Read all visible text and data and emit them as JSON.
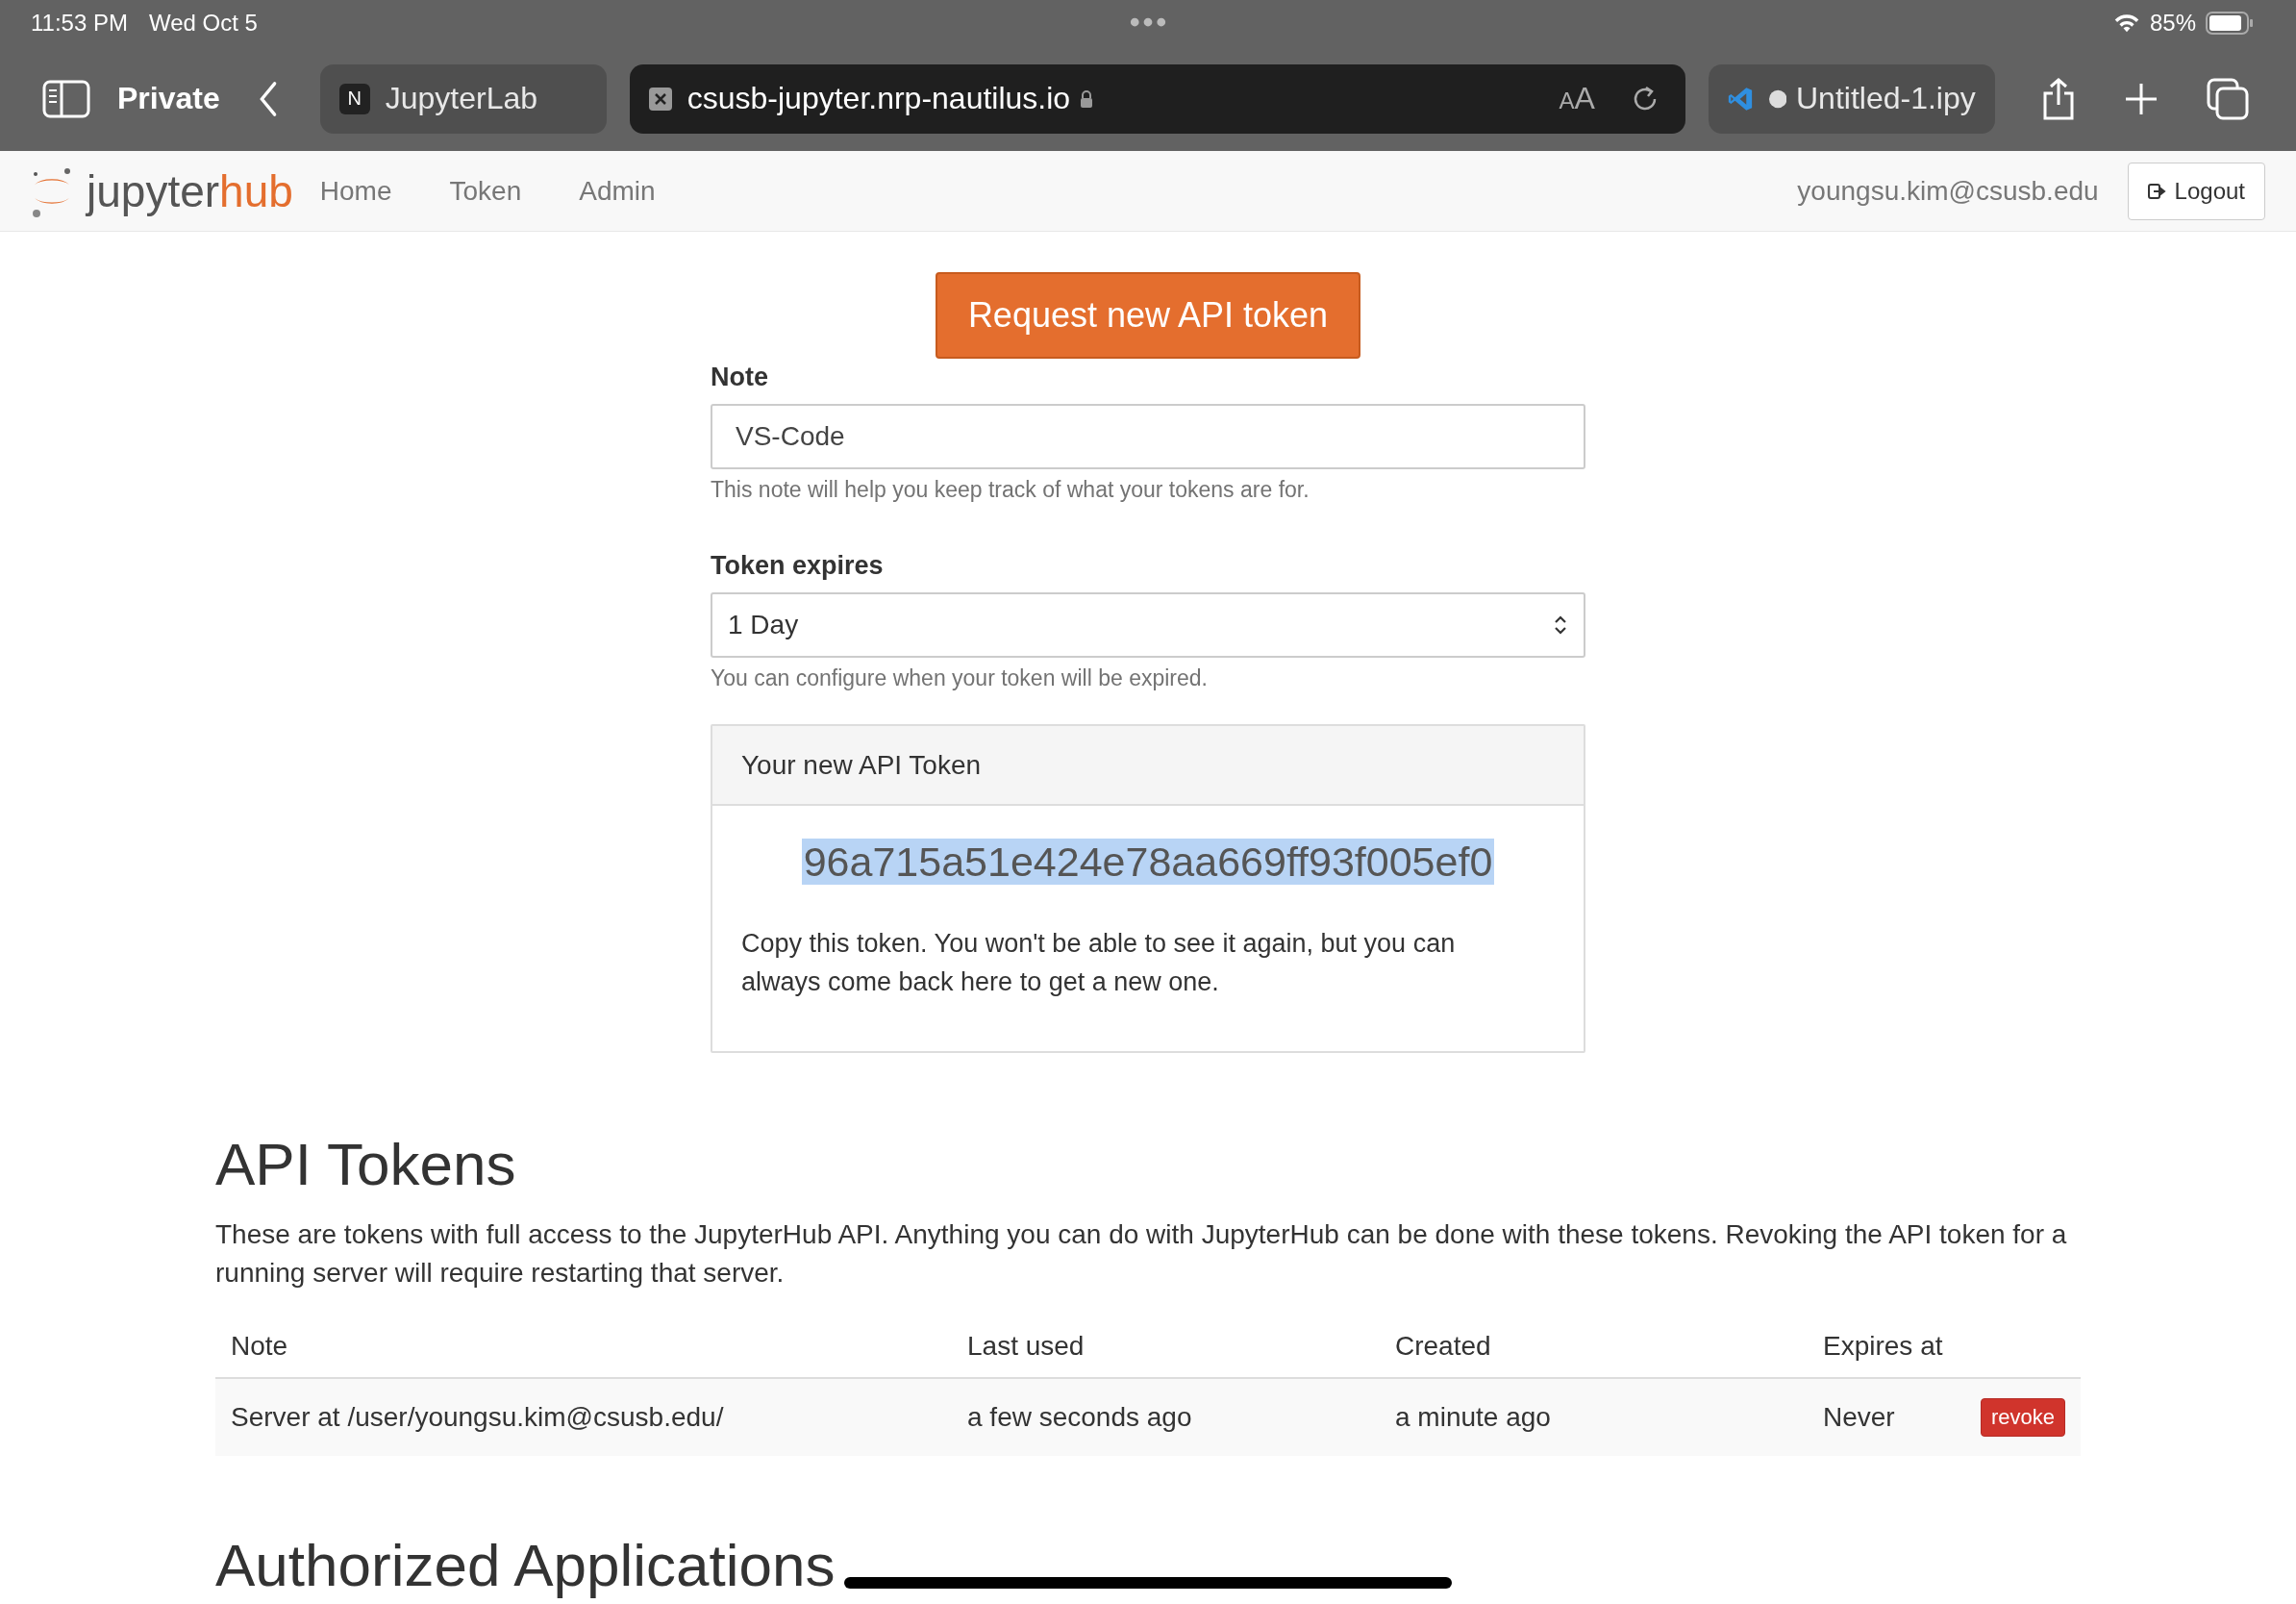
{
  "status_bar": {
    "time": "11:53 PM",
    "date": "Wed Oct 5",
    "battery": "85%"
  },
  "browser": {
    "private_label": "Private",
    "tabs": [
      {
        "kind": "page",
        "favicon": "N",
        "label": "JupyterLab",
        "selected": false
      },
      {
        "kind": "address",
        "label": "csusb-jupyter.nrp-nautilus.io",
        "reader": "AA",
        "selected": true
      },
      {
        "kind": "vscode",
        "label": "Untitled-1.ipy",
        "selected": false
      }
    ]
  },
  "navbar": {
    "logo_text": "jupyter",
    "logo_accent": "hub",
    "links": [
      "Home",
      "Token",
      "Admin"
    ],
    "user": "youngsu.kim@csusb.edu",
    "logout": "Logout"
  },
  "form": {
    "request_button": "Request new API token",
    "note_label": "Note",
    "note_value": "VS-Code",
    "note_help": "This note will help you keep track of what your tokens are for.",
    "expires_label": "Token expires",
    "expires_value": "1 Day",
    "expires_help": "You can configure when your token will be expired."
  },
  "new_token_panel": {
    "heading": "Your new API Token",
    "token": "96a715a51e424e78aa669ff93f005ef0",
    "token_selected": true,
    "message": "Copy this token. You won't be able to see it again, but you can always come back here to get a new one."
  },
  "api_tokens": {
    "title": "API Tokens",
    "description": "These are tokens with full access to the JupyterHub API. Anything you can do with JupyterHub can be done with these tokens. Revoking the API token for a running server will require restarting that server.",
    "table": {
      "columns": [
        "Note",
        "Last used",
        "Created",
        "Expires at"
      ],
      "rows": [
        {
          "note": "Server at /user/youngsu.kim@csusb.edu/",
          "last_used": "a few seconds ago",
          "created": "a minute ago",
          "expires": "Never",
          "action": "revoke"
        }
      ]
    }
  },
  "authorized_applications": {
    "title": "Authorized Applications"
  }
}
